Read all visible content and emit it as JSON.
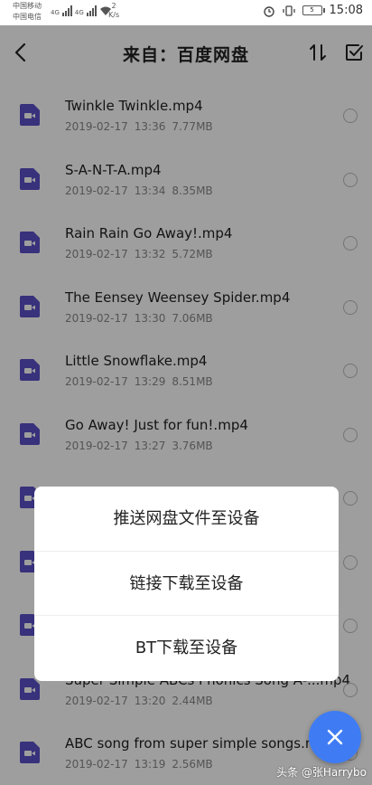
{
  "status": {
    "carrier1": "中国移动",
    "carrier2": "中国电信",
    "signal1": "4G",
    "signal2": "4G",
    "speed_value": "2",
    "speed_unit": "K/s",
    "battery": "5",
    "time": "15:08"
  },
  "nav": {
    "title": "来自：百度网盘"
  },
  "files": [
    {
      "name": "Twinkle Twinkle.mp4",
      "date": "2019-02-17",
      "time": "13:36",
      "size": "7.77MB"
    },
    {
      "name": "S-A-N-T-A.mp4",
      "date": "2019-02-17",
      "time": "13:34",
      "size": "8.35MB"
    },
    {
      "name": "Rain Rain Go Away!.mp4",
      "date": "2019-02-17",
      "time": "13:32",
      "size": "5.72MB"
    },
    {
      "name": "The Eensey Weensey Spider.mp4",
      "date": "2019-02-17",
      "time": "13:30",
      "size": "7.06MB"
    },
    {
      "name": "Little Snowflake.mp4",
      "date": "2019-02-17",
      "time": "13:29",
      "size": "8.51MB"
    },
    {
      "name": "Go Away! Just for fun!.mp4",
      "date": "2019-02-17",
      "time": "13:27",
      "size": "3.76MB"
    },
    {
      "name": "",
      "date": "",
      "time": "",
      "size": ""
    },
    {
      "name": "",
      "date": "",
      "time": "",
      "size": ""
    },
    {
      "name": "",
      "date": "",
      "time": "",
      "size": ""
    },
    {
      "name": "Super Simple ABCs Phonics Song A-...mp4",
      "date": "2019-02-17",
      "time": "13:20",
      "size": "2.44MB"
    },
    {
      "name": "ABC song from super simple songs.mp4",
      "date": "2019-02-17",
      "time": "13:19",
      "size": "2.56MB"
    }
  ],
  "popup": {
    "options": [
      "推送网盘文件至设备",
      "链接下载至设备",
      "BT下载至设备"
    ]
  },
  "fab": {
    "icon": "close-icon",
    "color": "#3f7cf4"
  },
  "file_icon_color": "#5b4fc7",
  "watermark": "头条 @张Harrybo"
}
